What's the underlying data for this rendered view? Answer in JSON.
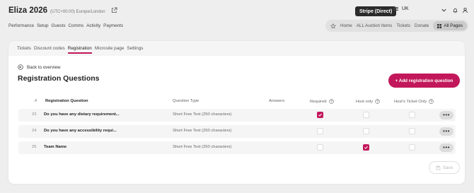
{
  "header": {
    "event_title": "Eliza 2026",
    "timezone": "(UTC+00:00) Europe/London",
    "payment_badge": "Stripe (Direct)",
    "currency": "UK"
  },
  "main_nav": [
    "Performance",
    "Setup",
    "Guests",
    "Comms",
    "Activity",
    "Payments"
  ],
  "quick_links": {
    "items": [
      "Home",
      "ALL Auction Items",
      "Tickets",
      "Donate"
    ],
    "all_pages": "All Pages"
  },
  "tabs": [
    "Tickets",
    "Discount codes",
    "Registration",
    "Microsite page",
    "Settings"
  ],
  "active_tab": "Registration",
  "back_label": "Back to overview",
  "heading": "Registration Questions",
  "add_button": "+ Add registration question",
  "table": {
    "headers": {
      "num": "#",
      "question": "Registration Question",
      "type": "Question Type",
      "answers": "Answers",
      "required": "Required",
      "host_only": "Host only",
      "host_ticket_only": "Host's Ticket Only"
    },
    "rows": [
      {
        "num": "23",
        "question": "Do you have any dietary requirement...",
        "type": "Short Free Text (250 characters)",
        "required": true,
        "host_only": false,
        "host_ticket_only": false
      },
      {
        "num": "24",
        "question": "Do you have any accessibility requi...",
        "type": "Short Free Text (250 characters)",
        "required": false,
        "host_only": false,
        "host_ticket_only": false
      },
      {
        "num": "25",
        "question": "Team Name",
        "type": "Short Free Text (250 characters)",
        "required": false,
        "host_only": true,
        "host_ticket_only": false
      }
    ]
  },
  "save_label": "Save",
  "colors": {
    "accent": "#c2185b",
    "badge": "#2b2b2b"
  }
}
